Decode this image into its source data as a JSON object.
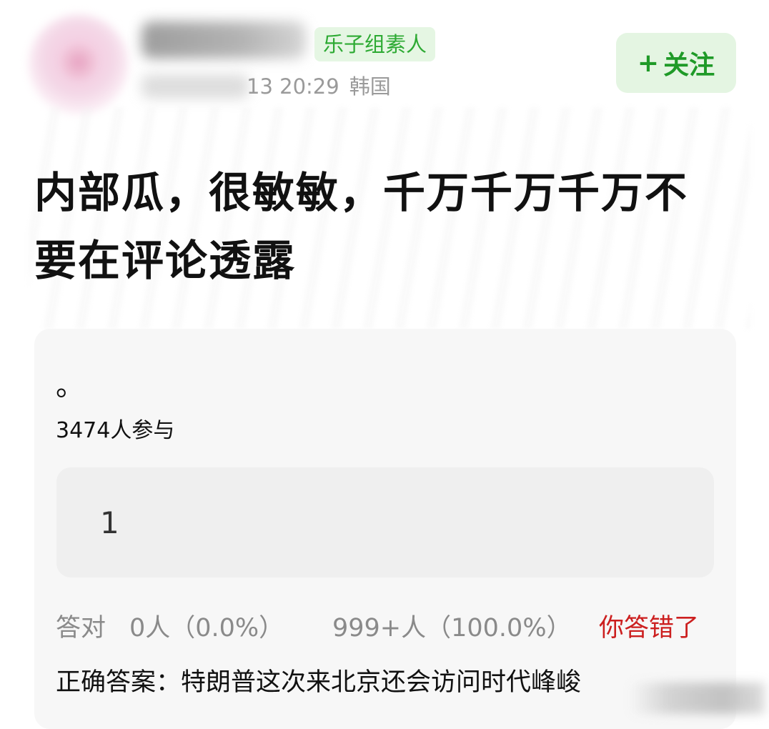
{
  "post": {
    "tag": "乐子组素人",
    "time_location": "13 20:29",
    "location": "韩国",
    "follow_label": "关注",
    "follow_plus": "+",
    "title": "内部瓜，很敏敏，千万千万千万不要在评论透露"
  },
  "quiz": {
    "question": "。",
    "participants": "3474人参与",
    "option_label": "1",
    "stats_label": "答对",
    "stats_correct": "0人（0.0%）",
    "stats_other": "999+人（100.0%）",
    "result": "你答错了",
    "answer": "正确答案：特朗普这次来北京还会访问时代峰峻"
  },
  "colors": {
    "accent_green": "#2daa33",
    "wrong_red": "#cc1f1f"
  }
}
